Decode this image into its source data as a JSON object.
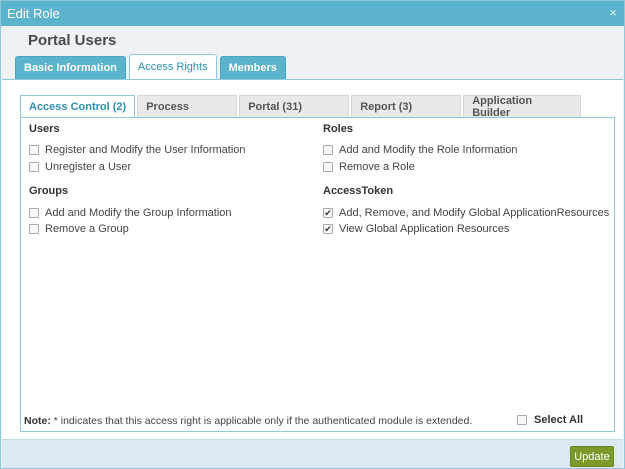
{
  "dialog": {
    "title": "Edit Role",
    "close_glyph": "×"
  },
  "header": {
    "title": "Portal Users"
  },
  "outer_tabs": [
    {
      "label": "Basic Information",
      "active": false
    },
    {
      "label": "Access Rights",
      "active": true
    },
    {
      "label": "Members",
      "active": false
    }
  ],
  "inner_tabs": [
    {
      "label": "Access Control (2)",
      "active": true
    },
    {
      "label": "Process",
      "active": false
    },
    {
      "label": "Portal (31)",
      "active": false
    },
    {
      "label": "Report (3)",
      "active": false
    },
    {
      "label": "Application Builder",
      "active": false
    }
  ],
  "sections": {
    "users": {
      "title": "Users",
      "items": [
        {
          "label": "Register and Modify the User Information",
          "checked": false
        },
        {
          "label": "Unregister a User",
          "checked": false
        }
      ]
    },
    "groups": {
      "title": "Groups",
      "items": [
        {
          "label": "Add and Modify the Group Information",
          "checked": false
        },
        {
          "label": "Remove a Group",
          "checked": false
        }
      ]
    },
    "roles": {
      "title": "Roles",
      "items": [
        {
          "label": "Add and Modify the Role Information",
          "checked": false
        },
        {
          "label": "Remove a Role",
          "checked": false
        }
      ]
    },
    "access_token": {
      "title": "AccessToken",
      "items": [
        {
          "label": "Add, Remove, and Modify Global ApplicationResources",
          "checked": true
        },
        {
          "label": "View Global Application Resources",
          "checked": true
        }
      ]
    }
  },
  "note": {
    "prefix": "Note:",
    "text": " * indicates that this access right is applicable only if the authenticated module is extended."
  },
  "select_all": {
    "label": "Select All",
    "checked": false
  },
  "footer": {
    "update_label": "Update"
  },
  "colors": {
    "accent": "#5bb3cc",
    "update_button": "#7b9a2a",
    "active_tab_text": "#2e8fb0"
  },
  "check_glyph": "✔"
}
